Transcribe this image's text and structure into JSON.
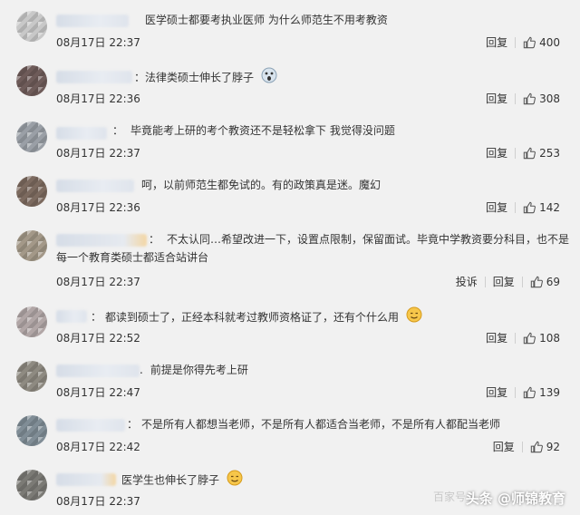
{
  "comments": [
    {
      "text": "医学硕士都要考执业医师 为什么师范生不用考教资",
      "date": "08月17日 22:37",
      "reply": "回复",
      "likes": "400"
    },
    {
      "text": "法律类硕士伸长了脖子",
      "date": "08月17日 22:36",
      "reply": "回复",
      "likes": "308",
      "emoji": "surprised-emoji"
    },
    {
      "text": "毕竟能考上研的考个教资还不是轻松拿下 我觉得没问题",
      "date": "08月17日 22:37",
      "reply": "回复",
      "likes": "253"
    },
    {
      "text": "呵，以前师范生都免试的。有的政策真是迷。魔幻",
      "date": "08月17日 22:36",
      "reply": "回复",
      "likes": "142"
    },
    {
      "text": "不太认同…希望改进一下，设置点限制，保留面试。毕竟中学教资要分科目，也不是每一个教育类硕士都适合站讲台",
      "date": "08月17日 22:37",
      "report": "投诉",
      "reply": "回复",
      "likes": "69"
    },
    {
      "text": "都读到硕士了，正经本科就考过教师资格证了，还有个什么用",
      "date": "08月17日 22:52",
      "reply": "回复",
      "likes": "108",
      "emoji": "smirk-emoji"
    },
    {
      "text": "前提是你得先考上研",
      "date": "08月17日 22:47",
      "reply": "回复",
      "likes": "139"
    },
    {
      "text": "不是所有人都想当老师，不是所有人都适合当老师，不是所有人都配当老师",
      "date": "08月17日 22:42",
      "reply": "回复",
      "likes": "92"
    },
    {
      "text": "医学生也伸长了脖子",
      "date": "08月17日 22:37",
      "emoji": "smirk-emoji"
    }
  ],
  "watermark": {
    "text": "头条 @师锦教育",
    "faint": "百家号"
  }
}
